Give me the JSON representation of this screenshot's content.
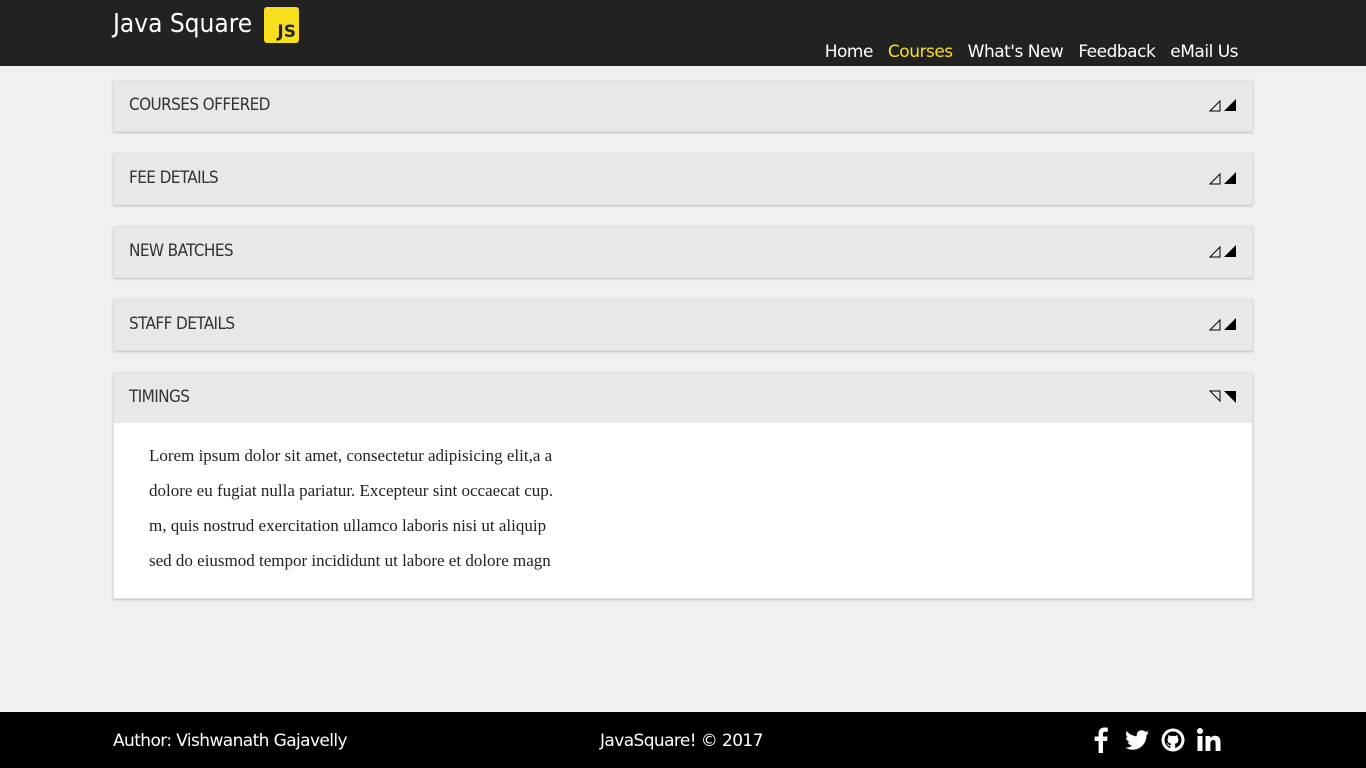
{
  "header": {
    "brand": "Java Square",
    "logo_text": "JS",
    "nav": [
      {
        "label": "Home",
        "active": false
      },
      {
        "label": "Courses",
        "active": true
      },
      {
        "label": "What's New",
        "active": false
      },
      {
        "label": "Feedback",
        "active": false
      },
      {
        "label": "eMail Us",
        "active": false
      }
    ],
    "accent_color": "#f7df1e"
  },
  "accordion": {
    "panels": [
      {
        "title": "COURSES OFFERED",
        "expanded": false
      },
      {
        "title": "FEE DETAILS",
        "expanded": false
      },
      {
        "title": "NEW BATCHES",
        "expanded": false
      },
      {
        "title": "STAFF DETAILS",
        "expanded": false
      },
      {
        "title": "TIMINGS",
        "expanded": true,
        "body_lines": [
          "Lorem ipsum dolor sit amet, consectetur adipisicing elit,a a",
          "dolore eu fugiat nulla pariatur. Excepteur sint occaecat cup.",
          "m, quis nostrud exercitation ullamco laboris nisi ut aliquip",
          "sed do eiusmod tempor incididunt ut labore et dolore magn"
        ]
      }
    ]
  },
  "footer": {
    "author": "Author: Vishwanath Gajavelly",
    "copyright": "JavaSquare! © 2017",
    "social": [
      "facebook-icon",
      "twitter-icon",
      "github-icon",
      "linkedin-icon"
    ]
  }
}
